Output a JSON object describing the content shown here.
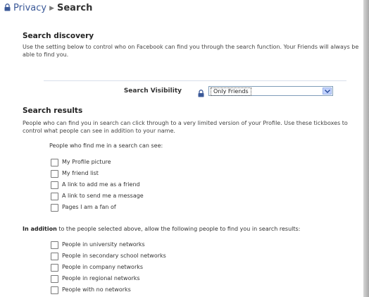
{
  "breadcrumb": {
    "parent": "Privacy",
    "separator": "▶",
    "current": "Search"
  },
  "search_discovery": {
    "title": "Search discovery",
    "description": "Use the setting below to control who on Facebook can find you through the search function. Your Friends will always be able to find you.",
    "visibility_label": "Search Visibility",
    "visibility_value": "Only Friends"
  },
  "search_results": {
    "title": "Search results",
    "description": "People who can find you in search can click through to a very limited version of your Profile. Use these tickboxes to control what people can see in addition to your name.",
    "see_prompt": "People who find me in a search can see:",
    "see_options": [
      {
        "label": "My Profile picture",
        "checked": false
      },
      {
        "label": "My friend list",
        "checked": false
      },
      {
        "label": "A link to add me as a friend",
        "checked": false
      },
      {
        "label": "A link to send me a message",
        "checked": false
      },
      {
        "label": "Pages I am a fan of",
        "checked": false
      }
    ],
    "addition_bold": "In addition",
    "addition_text": " to the people selected above, allow the following people to find you in search results:",
    "network_options": [
      {
        "label": "People in university networks",
        "checked": false
      },
      {
        "label": "People in secondary school networks",
        "checked": false
      },
      {
        "label": "People in company networks",
        "checked": false
      },
      {
        "label": "People in regional networks",
        "checked": false
      },
      {
        "label": "People with no networks",
        "checked": false
      }
    ]
  },
  "colors": {
    "link": "#3b5998",
    "divider": "#d8dfea",
    "select_border": "#7f9db9"
  },
  "icons": {
    "breadcrumb_lock": "lock-icon",
    "visibility_lock": "lock-icon",
    "dropdown": "chevron-down-icon"
  }
}
